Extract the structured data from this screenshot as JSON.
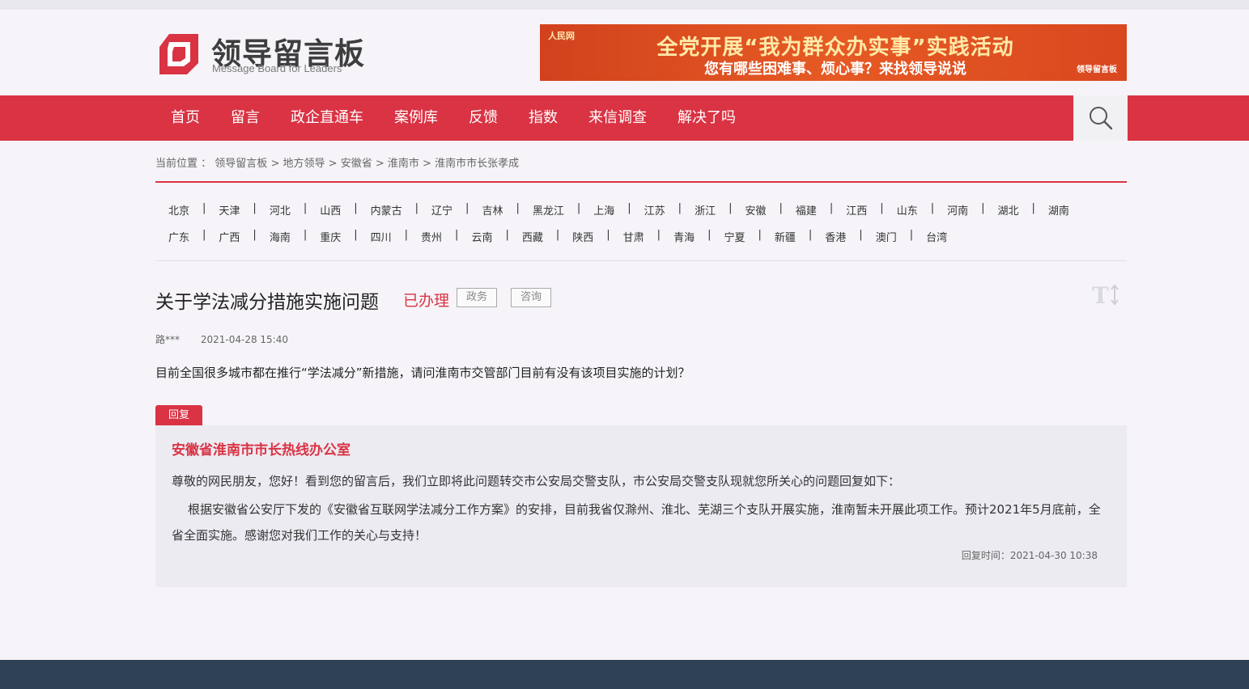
{
  "logo": {
    "cn": "领导留言板",
    "en": "Message Board for Leaders"
  },
  "banner": {
    "source": "人民网",
    "line1": "全党开展“我为群众办实事”实践活动",
    "line2": "您有哪些困难事、烦心事？来找领导说说",
    "mark": "领导留言板"
  },
  "nav": {
    "items": [
      "首页",
      "留言",
      "政企直通车",
      "案例库",
      "反馈",
      "指数",
      "来信调查",
      "解决了吗"
    ]
  },
  "breadcrumb": {
    "prefix": "当前位置 ：",
    "items": [
      "领导留言板",
      "地方领导",
      "安徽省",
      "淮南市",
      "淮南市市长张孝成"
    ],
    "separator": ">"
  },
  "provinces": {
    "row1": [
      "北京",
      "天津",
      "河北",
      "山西",
      "内蒙古",
      "辽宁",
      "吉林",
      "黑龙江",
      "上海",
      "江苏",
      "浙江",
      "安徽",
      "福建",
      "江西",
      "山东",
      "河南",
      "湖北",
      "湖南"
    ],
    "row2": [
      "广东",
      "广西",
      "海南",
      "重庆",
      "四川",
      "贵州",
      "云南",
      "西藏",
      "陕西",
      "甘肃",
      "青海",
      "宁夏",
      "新疆",
      "香港",
      "澳门",
      "台湾"
    ],
    "separator": "|"
  },
  "question": {
    "title": "关于学法减分措施实施问题",
    "status": "已办理",
    "tags": [
      "政务",
      "咨询"
    ],
    "author": "路***",
    "time": "2021-04-28 15:40",
    "body": "目前全国很多城市都在推行“学法减分”新措施，请问淮南市交管部门目前有没有该项目实施的计划？"
  },
  "reply": {
    "badge": "回复",
    "org": "安徽省淮南市市长热线办公室",
    "p1": "尊敬的网民朋友，您好！看到您的留言后，我们立即将此问题转交市公安局交警支队，市公安局交警支队现就您所关心的问题回复如下：",
    "p2": "根据安徽省公安厅下发的《安徽省互联网学法减分工作方案》的安排，目前我省仅滁州、淮北、芜湖三个支队开展实施，淮南暂未开展此项工作。预计2021年5月底前，全省全面实施。感谢您对我们工作的关心与支持！",
    "time": "回复时间：2021-04-30 10:38"
  },
  "colors": {
    "accent": "#d93344",
    "footer": "#2e4156",
    "background": "#f6f4f8",
    "reply_bg": "#ecebf1"
  },
  "icons": {
    "search": "search-icon",
    "font_size": "font-size-icon",
    "logo": "logo-mark-icon"
  }
}
